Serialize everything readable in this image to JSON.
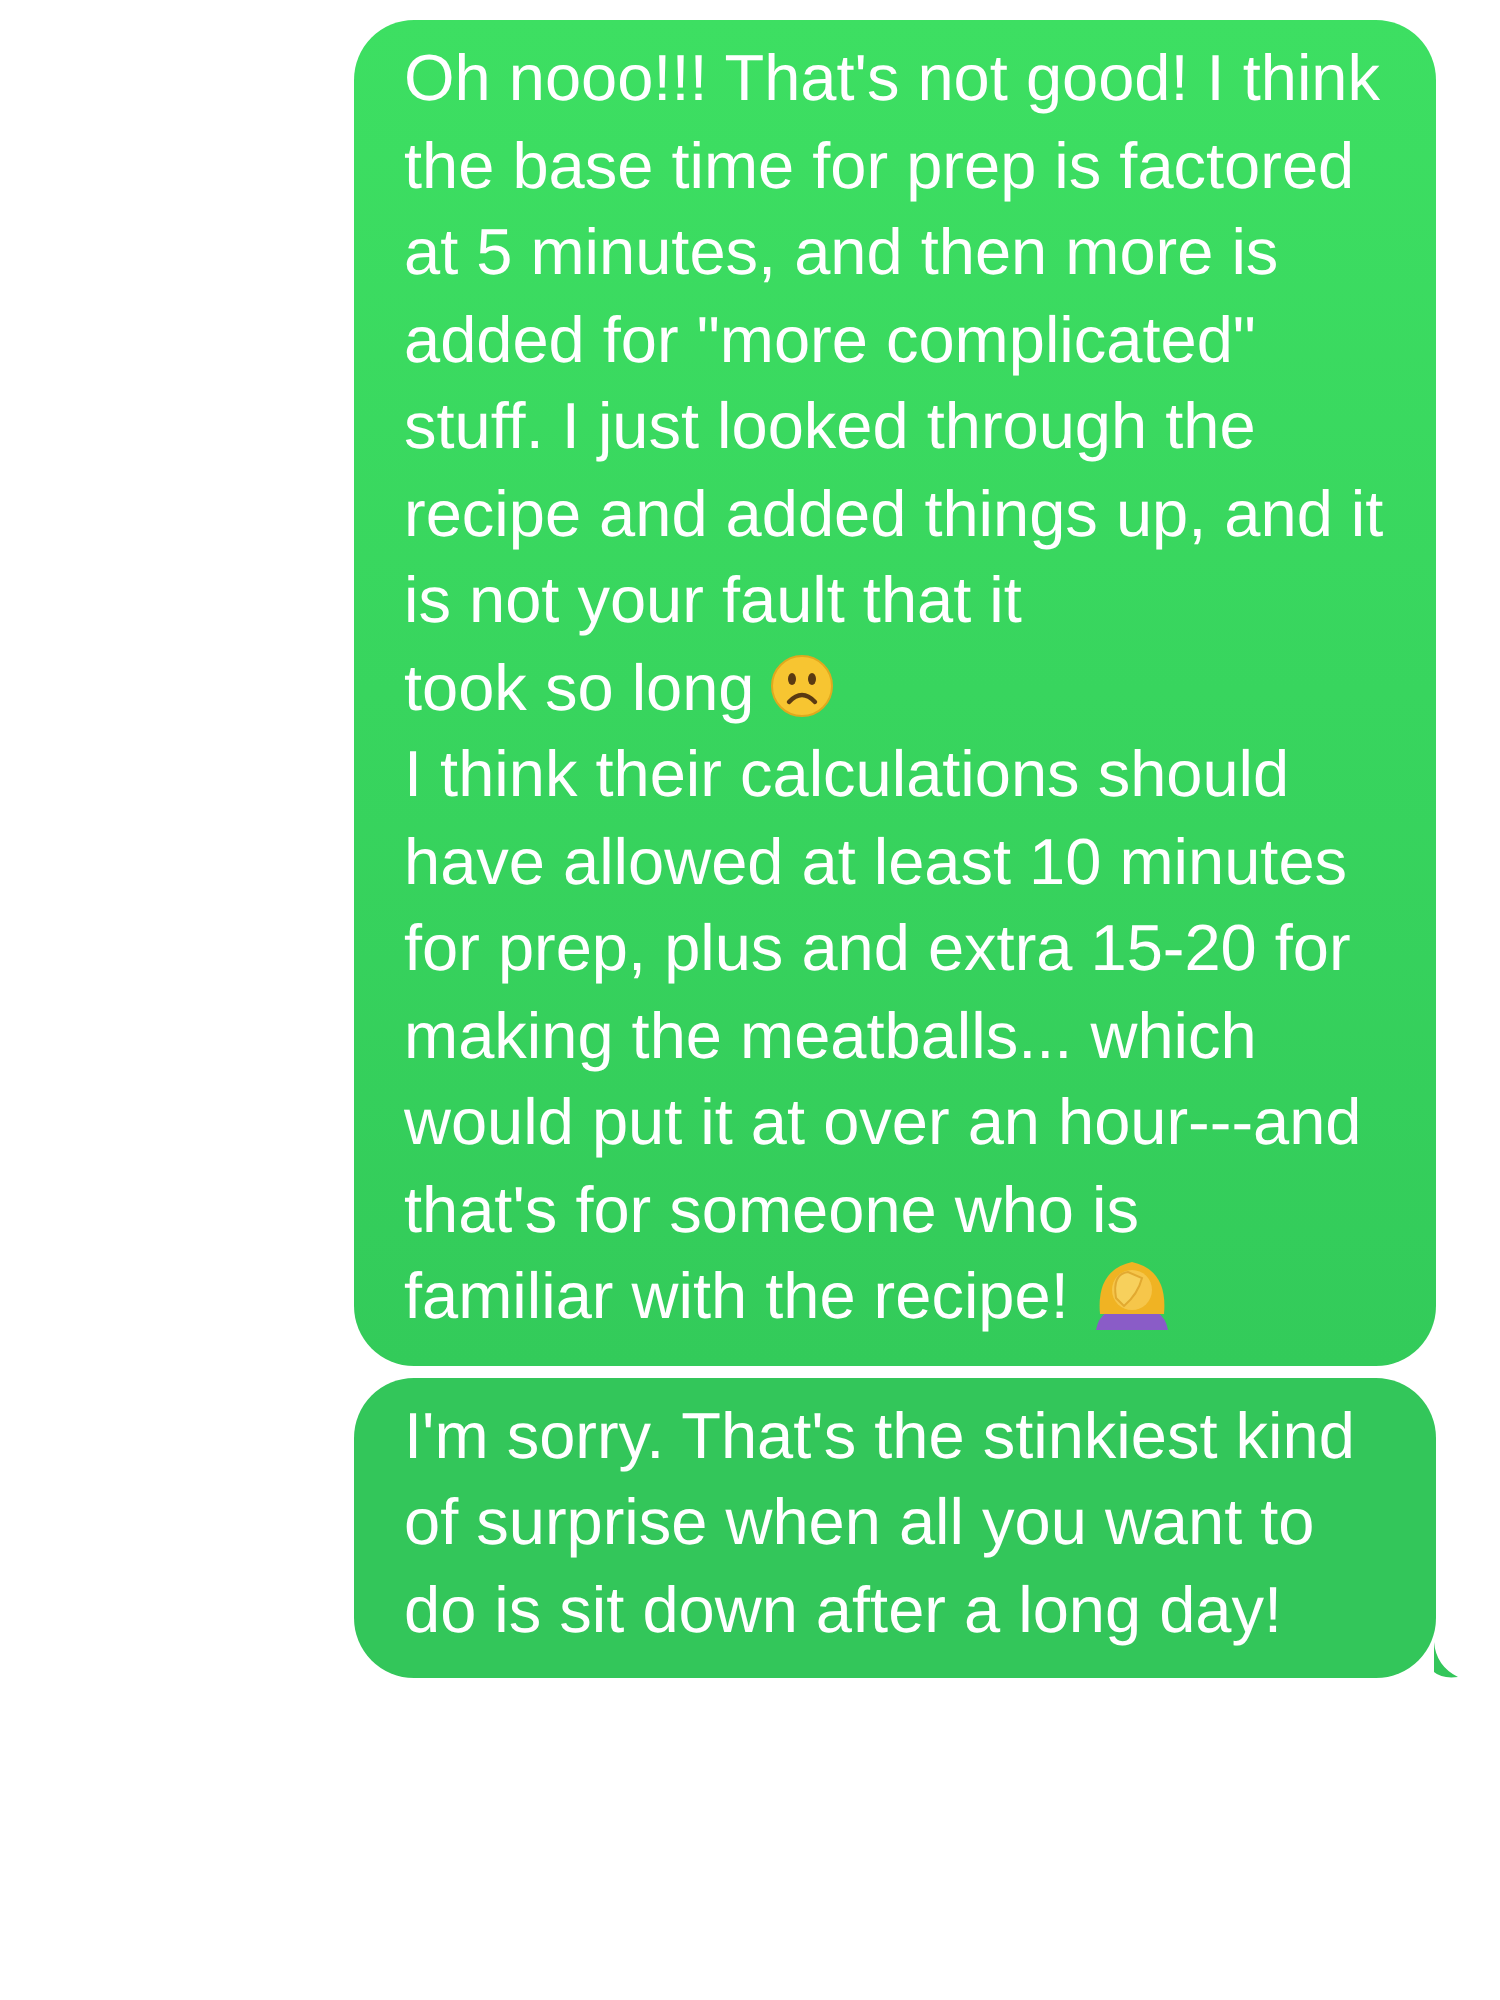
{
  "messages": [
    {
      "tail": false,
      "segments": [
        {
          "kind": "text",
          "text": "Oh nooo!!! That's not good! I think the base time for prep is factored at 5 minutes, and then more is added for \"more complicated\" stuff. I just looked through the recipe and added things up, and it is not your fault that it"
        },
        {
          "kind": "text",
          "text": "took so long"
        },
        {
          "kind": "frown"
        },
        {
          "kind": "text",
          "text": "I think their calculations should have allowed at least 10 minutes for prep, plus and extra 15-20 for making the meatballs... which would put it at over an hour---and that's for someone who is"
        },
        {
          "kind": "text",
          "text": "familiar with the recipe!"
        },
        {
          "kind": "facepalm"
        }
      ]
    },
    {
      "tail": true,
      "segments": [
        {
          "kind": "text",
          "text": "I'm sorry. That's the stinkiest kind of surprise when all you want to do is sit down after a long day!"
        }
      ]
    }
  ]
}
